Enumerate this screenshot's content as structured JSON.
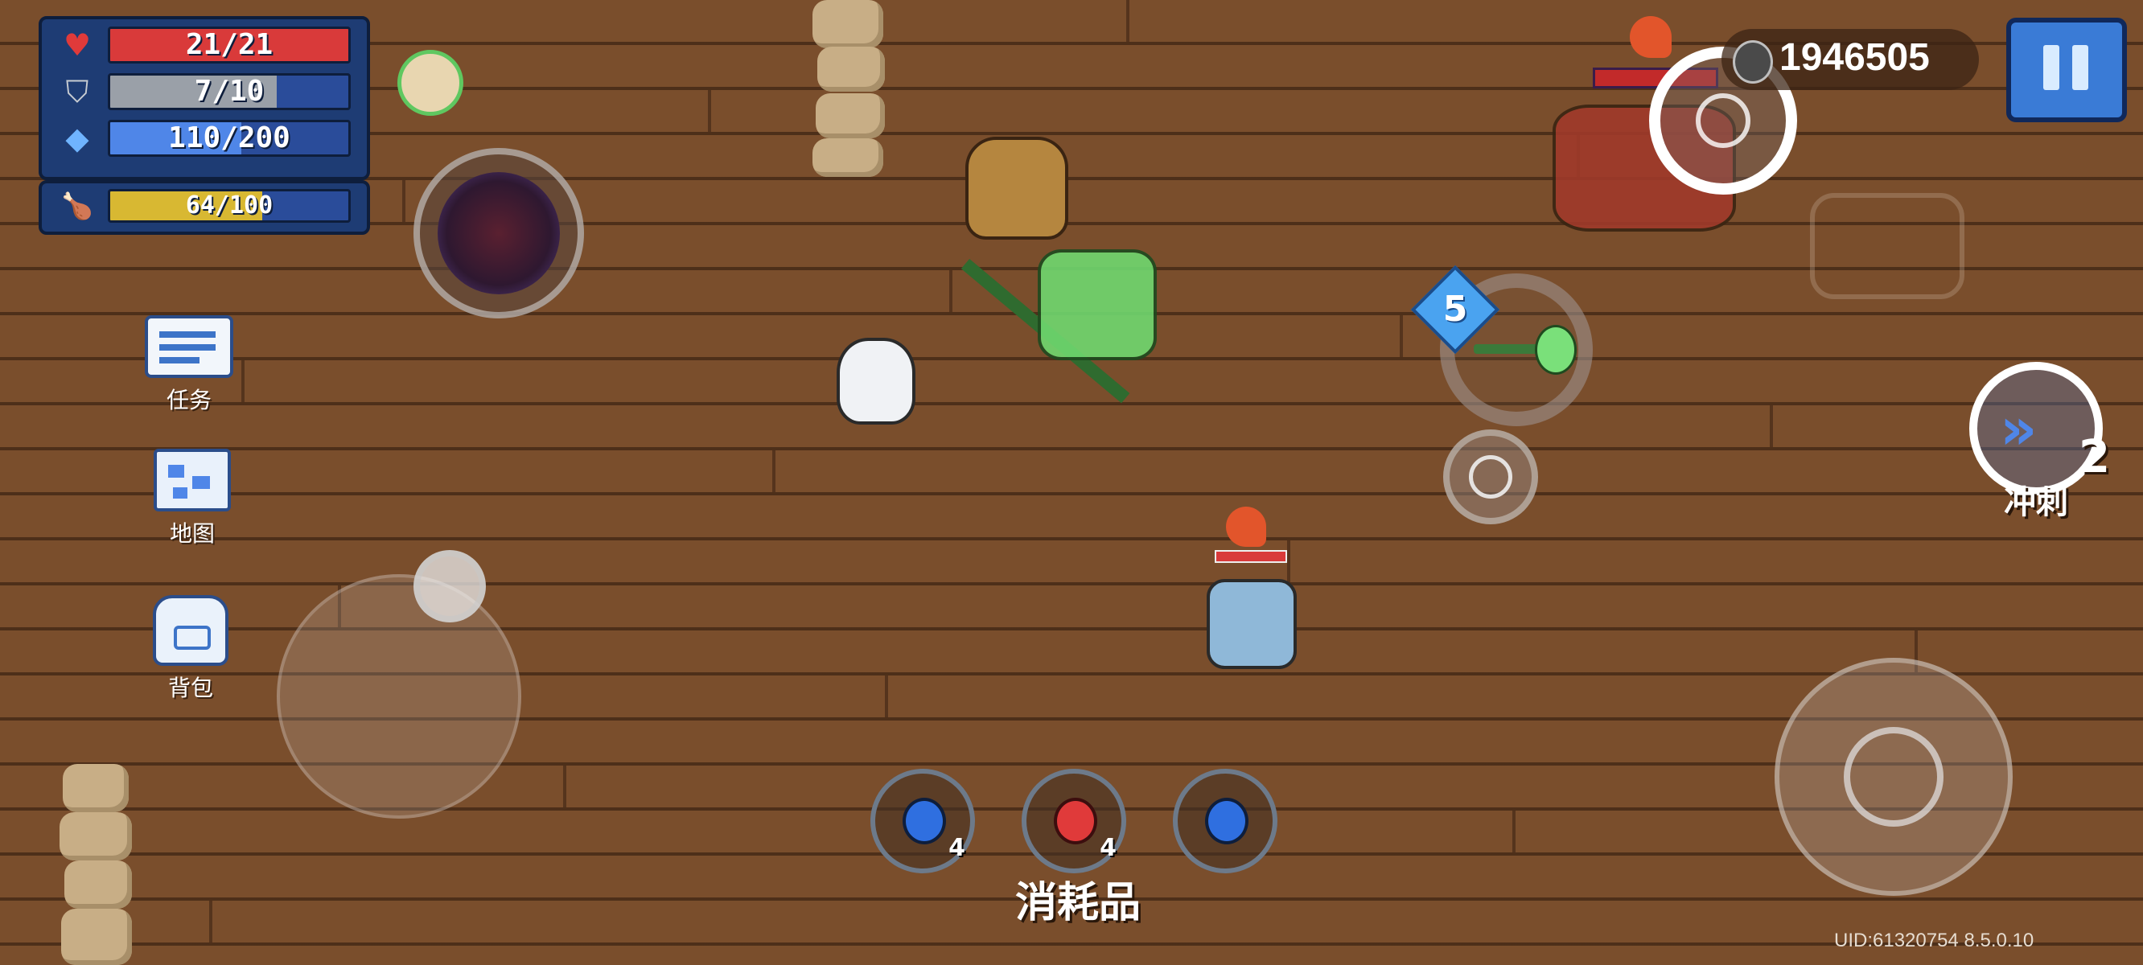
{
  "hud": {
    "health": {
      "text": "21/21",
      "fraction": 1.0,
      "color": "#d93a3a"
    },
    "armor": {
      "text": "7/10",
      "fraction": 0.7,
      "color": "#9aa0a8"
    },
    "energy": {
      "text": "110/200",
      "fraction": 0.55,
      "color": "#4f86e8"
    },
    "stamina": {
      "text": "64/100",
      "fraction": 0.64,
      "color": "#d8b832"
    }
  },
  "side_menu": {
    "tasks_label": "任务",
    "map_label": "地图",
    "backpack_label": "背包"
  },
  "coins": {
    "value": "1946505"
  },
  "weapon_swap": {
    "ammo_badge": "5"
  },
  "dash": {
    "label": "冲刺",
    "charges": "2"
  },
  "consumables": {
    "label": "消耗品",
    "items": [
      {
        "icon": "blue-potion-icon",
        "count": "4",
        "color": "#2f6fe0"
      },
      {
        "icon": "red-potion-icon",
        "count": "4",
        "color": "#e03a3a"
      },
      {
        "icon": "blue-potion-icon",
        "count": "",
        "color": "#2f6fe0"
      }
    ]
  },
  "footer": {
    "uid_text": "UID:61320754  8.5.0.10"
  },
  "icons": {
    "heart": "heart-icon",
    "shield": "shield-icon",
    "gem": "energy-gem-icon",
    "drumstick": "stamina-drumstick-icon"
  }
}
